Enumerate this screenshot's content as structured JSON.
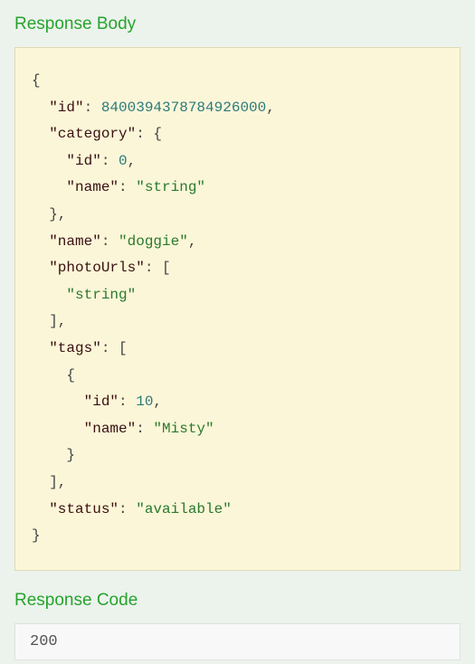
{
  "headers": {
    "response_body": "Response Body",
    "response_code": "Response Code"
  },
  "response_body": {
    "id_key": "\"id\"",
    "id_val": "8400394378784926000",
    "category_key": "\"category\"",
    "cat_id_key": "\"id\"",
    "cat_id_val": "0",
    "cat_name_key": "\"name\"",
    "cat_name_val": "\"string\"",
    "name_key": "\"name\"",
    "name_val": "\"doggie\"",
    "photo_key": "\"photoUrls\"",
    "photo_item": "\"string\"",
    "tags_key": "\"tags\"",
    "tag_id_key": "\"id\"",
    "tag_id_val": "10",
    "tag_name_key": "\"name\"",
    "tag_name_val": "\"Misty\"",
    "status_key": "\"status\"",
    "status_val": "\"available\""
  },
  "response_code": "200"
}
